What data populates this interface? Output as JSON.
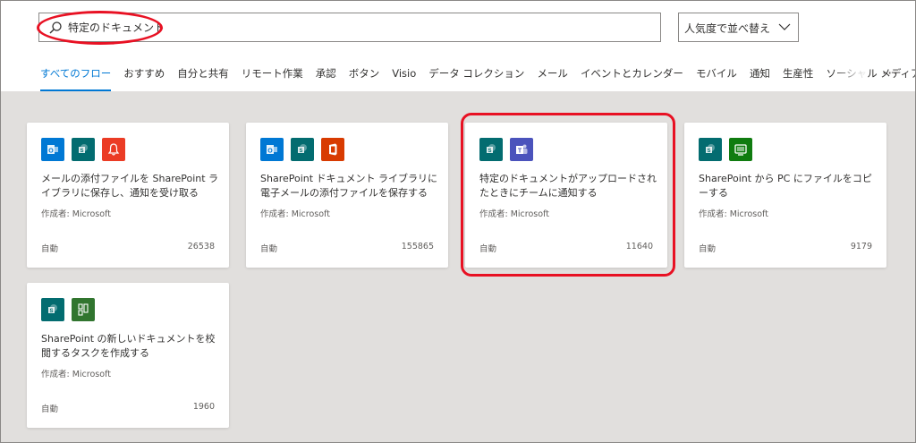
{
  "search": {
    "value": "特定のドキュメント"
  },
  "sort": {
    "label": "人気度で並べ替え"
  },
  "tabs": [
    {
      "label": "すべてのフロー"
    },
    {
      "label": "おすすめ"
    },
    {
      "label": "自分と共有"
    },
    {
      "label": "リモート作業"
    },
    {
      "label": "承認"
    },
    {
      "label": "ボタン"
    },
    {
      "label": "Visio"
    },
    {
      "label": "データ コレクション"
    },
    {
      "label": "メール"
    },
    {
      "label": "イベントとカレンダー"
    },
    {
      "label": "モバイル"
    },
    {
      "label": "通知"
    },
    {
      "label": "生産性"
    },
    {
      "label": "ソーシャル メディア"
    }
  ],
  "more_label": "···",
  "cards": [
    {
      "title": "メールの添付ファイルを SharePoint ライブラリに保存し、通知を受け取る",
      "author": "作成者: Microsoft",
      "type": "自動",
      "count": "26538",
      "icons": [
        "outlook-icon",
        "sharepoint-icon",
        "notification-icon"
      ]
    },
    {
      "title": "SharePoint ドキュメント ライブラリに電子メールの添付ファイルを保存する",
      "author": "作成者: Microsoft",
      "type": "自動",
      "count": "155865",
      "icons": [
        "outlook-icon",
        "sharepoint-icon",
        "office365-icon"
      ]
    },
    {
      "title": "特定のドキュメントがアップロードされたときにチームに通知する",
      "author": "作成者: Microsoft",
      "type": "自動",
      "count": "11640",
      "icons": [
        "sharepoint-icon",
        "teams-icon"
      ]
    },
    {
      "title": "SharePoint から PC にファイルをコピーする",
      "author": "作成者: Microsoft",
      "type": "自動",
      "count": "9179",
      "icons": [
        "sharepoint-icon",
        "pc-icon"
      ]
    },
    {
      "title": "SharePoint の新しいドキュメントを校閲するタスクを作成する",
      "author": "作成者: Microsoft",
      "type": "自動",
      "count": "1960",
      "icons": [
        "sharepoint-icon",
        "planner-icon"
      ]
    }
  ],
  "colors": {
    "accent": "#0078d4",
    "highlight": "#e81123",
    "content_bg": "#e1dfdd"
  }
}
